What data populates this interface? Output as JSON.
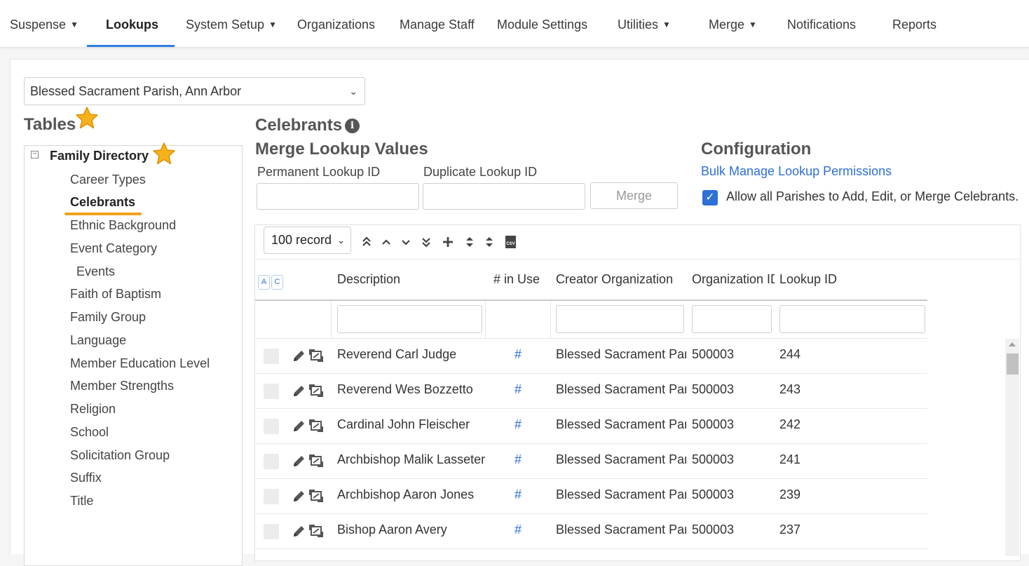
{
  "nav": {
    "items": [
      {
        "label": "Suspense",
        "dropdown": true
      },
      {
        "label": "Lookups",
        "dropdown": false,
        "active": true
      },
      {
        "label": "System Setup",
        "dropdown": true
      },
      {
        "label": "Organizations",
        "dropdown": false
      },
      {
        "label": "Manage Staff",
        "dropdown": false
      },
      {
        "label": "Module Settings",
        "dropdown": false
      },
      {
        "label": "Utilities",
        "dropdown": true
      },
      {
        "label": "Merge",
        "dropdown": true
      },
      {
        "label": "Notifications",
        "dropdown": false
      },
      {
        "label": "Reports",
        "dropdown": false
      }
    ],
    "caret": "▼",
    "accent": "#2f7de1"
  },
  "parish_select": {
    "value": "Blessed Sacrament Parish, Ann Arbor",
    "chevron": "⌄"
  },
  "tables": {
    "heading": "Tables",
    "toggle": "−",
    "root": "Family Directory",
    "items": [
      "Career Types",
      "Celebrants",
      "Ethnic Background",
      "Event Category",
      "Events",
      "Faith of Baptism",
      "Family Group",
      "Language",
      "Member Education Level",
      "Member Strengths",
      "Religion",
      "School",
      "Solicitation Group",
      "Suffix",
      "Title"
    ],
    "selected": "Celebrants",
    "highlight_color": "#f0a21f"
  },
  "main": {
    "title": "Celebrants",
    "info_icon": "i",
    "merge": {
      "heading": "Merge Lookup Values",
      "permanent_label": "Permanent Lookup ID",
      "duplicate_label": "Duplicate Lookup ID",
      "permanent_value": "",
      "duplicate_value": "",
      "button": "Merge"
    },
    "config": {
      "heading": "Configuration",
      "link": "Bulk Manage Lookup Permissions",
      "checkbox_checked": true,
      "checkmark": "✓",
      "checkbox_label": "Allow all Parishes to Add, Edit, or Merge Celebrants."
    }
  },
  "grid": {
    "page_size": "100 record",
    "page_size_chevron": "⌄",
    "toolbar_icons": {
      "first": "«",
      "prev": "^",
      "next": "v",
      "last": "»",
      "add": "+",
      "expand": "⬍",
      "collapse": "⬍",
      "csv": "CSV"
    },
    "sort_buttons": [
      "A",
      "C"
    ],
    "columns": [
      "Description",
      "# in Use",
      "Creator Organization",
      "Organization ID",
      "Lookup ID"
    ],
    "rows": [
      {
        "description": "Reverend Carl Judge",
        "in_use": "#",
        "creator": "Blessed Sacrament Parish, Ann Arbor",
        "org_id": "500003",
        "lookup_id": "244"
      },
      {
        "description": "Reverend Wes Bozzetto",
        "in_use": "#",
        "creator": "Blessed Sacrament Parish, Ann Arbor",
        "org_id": "500003",
        "lookup_id": "243"
      },
      {
        "description": "Cardinal John Fleischer",
        "in_use": "#",
        "creator": "Blessed Sacrament Parish, Ann Arbor",
        "org_id": "500003",
        "lookup_id": "242"
      },
      {
        "description": "Archbishop Malik Lasseter",
        "in_use": "#",
        "creator": "Blessed Sacrament Parish, Ann Arbor",
        "org_id": "500003",
        "lookup_id": "241"
      },
      {
        "description": "Archbishop Aaron Jones",
        "in_use": "#",
        "creator": "Blessed Sacrament Parish, Ann Arbor",
        "org_id": "500003",
        "lookup_id": "239"
      },
      {
        "description": "Bishop Aaron Avery",
        "in_use": "#",
        "creator": "Blessed Sacrament Parish, Ann Arbor",
        "org_id": "500003",
        "lookup_id": "237"
      }
    ]
  }
}
